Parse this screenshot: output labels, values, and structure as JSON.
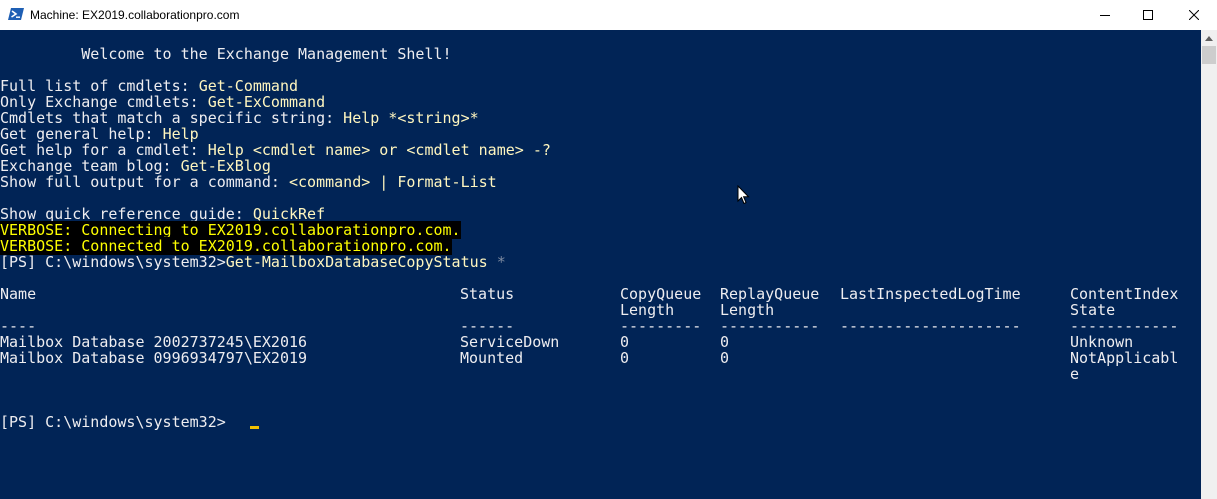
{
  "window": {
    "title": "Machine: EX2019.collaborationpro.com",
    "controls": [
      "minimize-icon",
      "maximize-icon",
      "close-icon"
    ]
  },
  "colors": {
    "background": "#012456",
    "text": "#eeedf0",
    "command_text": "#fff6bf",
    "verbose_text": "#ffff00",
    "verbose_bg": "#000000"
  },
  "console": {
    "welcome": "         Welcome to the Exchange Management Shell!",
    "help": [
      {
        "label": "Full list of cmdlets: ",
        "cmd": "Get-Command"
      },
      {
        "label": "Only Exchange cmdlets: ",
        "cmd": "Get-ExCommand"
      },
      {
        "label": "Cmdlets that match a specific string: ",
        "cmd": "Help *<string>*"
      },
      {
        "label": "Get general help: ",
        "cmd": "Help"
      },
      {
        "label": "Get help for a cmdlet: ",
        "cmd": "Help <cmdlet name> or <cmdlet name> -?"
      },
      {
        "label": "Exchange team blog: ",
        "cmd": "Get-ExBlog"
      },
      {
        "label": "Show full output for a command: ",
        "cmd": "<command> | Format-List"
      }
    ],
    "quickref": {
      "label": "Show quick reference guide: ",
      "cmd": "QuickRef"
    },
    "verbose": [
      "VERBOSE: Connecting to EX2019.collaborationpro.com.",
      "VERBOSE: Connected to EX2019.collaborationpro.com."
    ],
    "command": {
      "prompt": "[PS] C:\\windows\\system32>",
      "cmdlet": "Get-MailboxDatabaseCopyStatus",
      "arg": "*"
    },
    "table": {
      "headers": [
        {
          "l1": "Name",
          "l2": ""
        },
        {
          "l1": "Status",
          "l2": ""
        },
        {
          "l1": "CopyQueue",
          "l2": "Length"
        },
        {
          "l1": "ReplayQueue",
          "l2": "Length"
        },
        {
          "l1": "LastInspectedLogTime",
          "l2": ""
        },
        {
          "l1": "ContentIndex",
          "l2": "State"
        }
      ],
      "separators": [
        "----",
        "------",
        "---------",
        "-----------",
        "--------------------",
        "------------"
      ],
      "rows": [
        {
          "name": "Mailbox Database 2002737245\\EX2016",
          "status": "ServiceDown",
          "copyqueue": "0",
          "replayqueue": "0",
          "lastinspected": "",
          "ci_state_1": "Unknown",
          "ci_state_2": ""
        },
        {
          "name": "Mailbox Database 0996934797\\EX2019",
          "status": "Mounted",
          "copyqueue": "0",
          "replayqueue": "0",
          "lastinspected": "",
          "ci_state_1": "NotApplicabl",
          "ci_state_2": "e"
        }
      ]
    },
    "final_prompt": "[PS] C:\\windows\\system32>"
  }
}
